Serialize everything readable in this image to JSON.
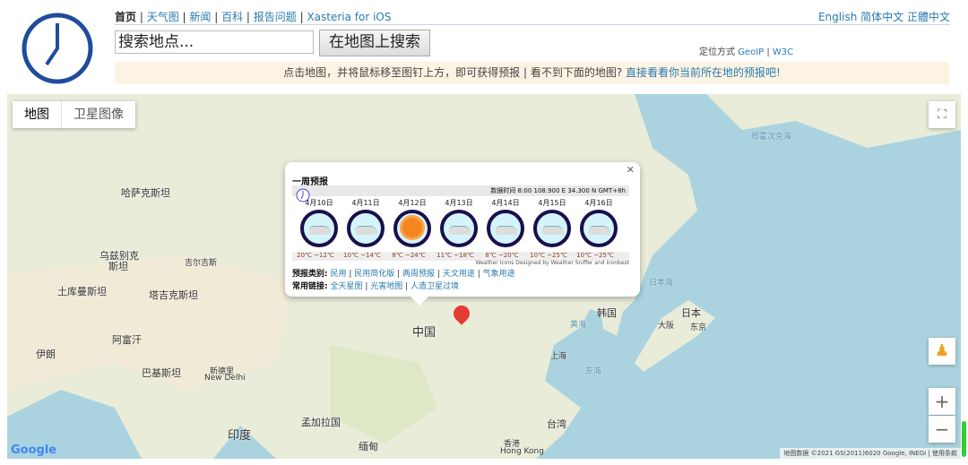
{
  "header": {
    "nav": [
      {
        "label": "首页",
        "active": true
      },
      {
        "label": "天气图"
      },
      {
        "label": "新闻"
      },
      {
        "label": "百科"
      },
      {
        "label": "报告问题"
      },
      {
        "label": "Xasteria for iOS"
      }
    ],
    "lang": [
      "English",
      "简体中文",
      "正體中文"
    ],
    "search_placeholder": "搜索地点...",
    "search_button": "在地图上搜索",
    "locate_label": "定位方式",
    "locate_options": [
      "GeoIP",
      "W3C"
    ],
    "notice_text": "点击地图，并将鼠标移至图钉上方，即可获得预报 | 看不到下面的地图? ",
    "notice_link": "直接看看你当前所在地的预报吧!"
  },
  "map": {
    "type_buttons": [
      "地图",
      "卫星图像"
    ],
    "labels": [
      {
        "t": "哈萨克斯坦"
      },
      {
        "t": "乌兹别克"
      },
      {
        "t": "斯坦"
      },
      {
        "t": "土库曼斯坦"
      },
      {
        "t": "塔吉克斯坦"
      },
      {
        "t": "吉尔吉斯"
      },
      {
        "t": "阿富汗"
      },
      {
        "t": "伊朗"
      },
      {
        "t": "巴基斯坦"
      },
      {
        "t": "新德里"
      },
      {
        "t": "New Delhi"
      },
      {
        "t": "印度"
      },
      {
        "t": "中国"
      },
      {
        "t": "孟加拉国"
      },
      {
        "t": "缅甸"
      },
      {
        "t": "香港"
      },
      {
        "t": "Hong Kong"
      },
      {
        "t": "台湾"
      },
      {
        "t": "上海"
      },
      {
        "t": "韩国"
      },
      {
        "t": "日本"
      },
      {
        "t": "大阪"
      },
      {
        "t": "东京"
      }
    ],
    "sea_labels": [
      "鄂霍次克海",
      "日本海",
      "黄海",
      "东海"
    ],
    "attribution": "地图数据 ©2021 GS(2011)6020 Google, INEGI",
    "terms": "使用条款",
    "google": "Google"
  },
  "popup": {
    "title": "一周预报",
    "data_time": "数据时间 8:00 108.900 E 34.300 N GMT+8h",
    "days": [
      {
        "date": "4月10日",
        "hi": "20℃",
        "lo": "~12℃",
        "icon": "cloudy"
      },
      {
        "date": "4月11日",
        "hi": "10℃",
        "lo": "~14℃",
        "icon": "cloudy"
      },
      {
        "date": "4月12日",
        "hi": "8℃",
        "lo": "~24℃",
        "icon": "sunny"
      },
      {
        "date": "4月13日",
        "hi": "11℃",
        "lo": "~18℃",
        "icon": "cloudy"
      },
      {
        "date": "4月14日",
        "hi": "8℃",
        "lo": "~20℃",
        "icon": "cloudy"
      },
      {
        "date": "4月15日",
        "hi": "10℃",
        "lo": "~25℃",
        "icon": "cloudy"
      },
      {
        "date": "4月16日",
        "hi": "10℃",
        "lo": "~25℃",
        "icon": "cloudy"
      }
    ],
    "credit": "Weather Icons Designed by Weather Sniffer and Iconbest",
    "cat_label": "预报类别:",
    "cats": [
      "民用",
      "民用简化版",
      "两周预报",
      "天文用途",
      "气象用途"
    ],
    "links_label": "常用链接:",
    "links": [
      "全天星图",
      "光害地图",
      "人造卫星过境"
    ]
  }
}
